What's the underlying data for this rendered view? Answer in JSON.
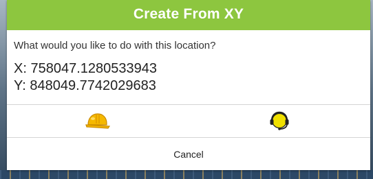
{
  "dialog": {
    "title": "Create From XY",
    "message": "What would you like to do with this location?",
    "x_line": "X: 758047.1280533943",
    "y_line": "Y: 848049.7742029683",
    "actions": [
      {
        "icon": "hard-hat-icon",
        "color": "#f5b800"
      },
      {
        "icon": "headset-icon",
        "color": "#f0e000"
      }
    ],
    "cancel_label": "Cancel"
  },
  "colors": {
    "title_bar": "#8dc63f",
    "title_text": "#ffffff"
  }
}
